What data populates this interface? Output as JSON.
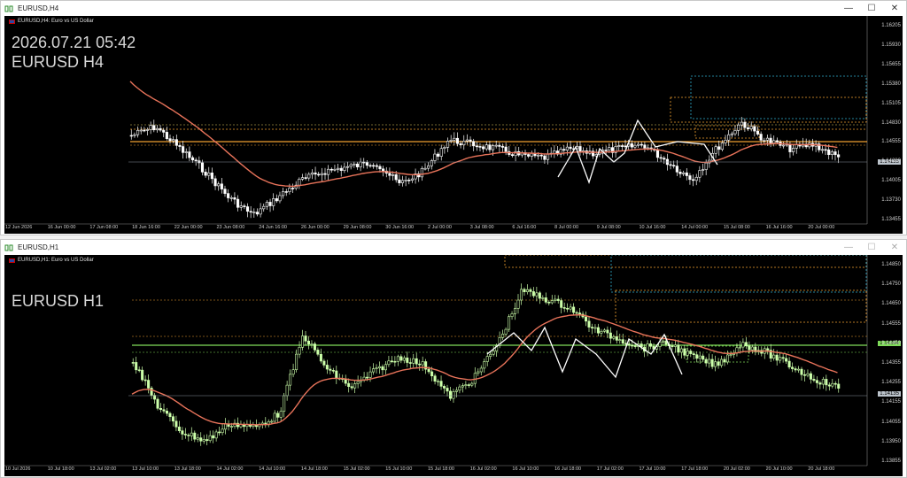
{
  "top_window": {
    "title": "EURUSD,H4",
    "symbol_line": "EURUSD,H4:  Euro vs US Dollar",
    "datetime": "2026.07.21 05:42",
    "label": "EURUSD H4",
    "price_ticks": [
      "1.16205",
      "1.15930",
      "1.15655",
      "1.15380",
      "1.15105",
      "1.14830",
      "1.14555",
      "1.14280",
      "1.14005",
      "1.13730",
      "1.13455"
    ],
    "current_price": "1.14135",
    "time_labels": [
      "12 Jun 2026",
      "16 Jun 00:00",
      "17 Jun 08:00",
      "18 Jun 16:00",
      "22 Jun 00:00",
      "23 Jun 08:00",
      "24 Jun 16:00",
      "26 Jun 00:00",
      "29 Jun 08:00",
      "30 Jun 16:00",
      "2 Jul 00:00",
      "3 Jul 08:00",
      "6 Jul 16:00",
      "8 Jul 00:00",
      "9 Jul 08:00",
      "10 Jul 16:00",
      "14 Jul 00:00",
      "15 Jul 08:00",
      "16 Jul 16:00",
      "20 Jul 00:00"
    ]
  },
  "bottom_window": {
    "title": "EURUSD,H1",
    "symbol_line": "EURUSD,H1:  Euro vs US Dollar",
    "label": "EURUSD H1",
    "price_ticks": [
      "1.14850",
      "1.14750",
      "1.14650",
      "1.14555",
      "1.14450",
      "1.14355",
      "1.14255",
      "1.14155",
      "1.14055",
      "1.13950",
      "1.13855"
    ],
    "current_price": "1.14135",
    "highlight_price": "1.14394",
    "time_labels": [
      "10 Jul 2026",
      "10 Jul 18:00",
      "13 Jul 02:00",
      "13 Jul 10:00",
      "13 Jul 18:00",
      "14 Jul 02:00",
      "14 Jul 10:00",
      "14 Jul 18:00",
      "15 Jul 02:00",
      "15 Jul 10:00",
      "15 Jul 18:00",
      "16 Jul 02:00",
      "16 Jul 10:00",
      "16 Jul 18:00",
      "17 Jul 02:00",
      "17 Jul 10:00",
      "17 Jul 18:00",
      "20 Jul 02:00",
      "20 Jul 10:00",
      "20 Jul 18:00"
    ]
  },
  "window_controls": {
    "minimize": "—",
    "maximize": "☐",
    "close": "✕"
  },
  "colors": {
    "bull": "#ffffff",
    "bear": "#ffffff",
    "h1_candle": "#ccffaa",
    "ma": "#e8735a",
    "zigzag": "#ffffff",
    "level_orange": "#f0a030",
    "level_green": "#7fdc5a",
    "level_cyan": "#30b0d0"
  }
}
